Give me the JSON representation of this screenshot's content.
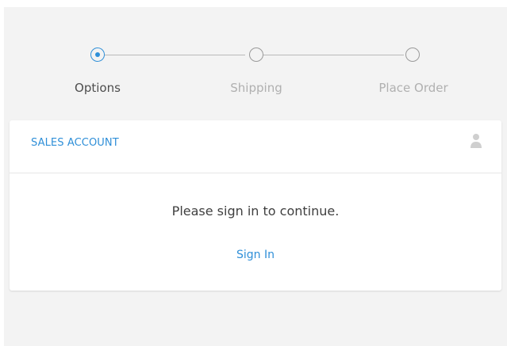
{
  "stepper": {
    "steps": [
      {
        "label": "Options",
        "state": "active"
      },
      {
        "label": "Shipping",
        "state": "inactive"
      },
      {
        "label": "Place Order",
        "state": "inactive"
      }
    ]
  },
  "card": {
    "title": "SALES ACCOUNT",
    "user_icon": "user-icon",
    "message": "Please sign in to continue.",
    "signin_label": "Sign In"
  },
  "colors": {
    "accent": "#2f8fd8",
    "inactive_text": "#b0b0b0",
    "background": "#f3f3f3"
  }
}
